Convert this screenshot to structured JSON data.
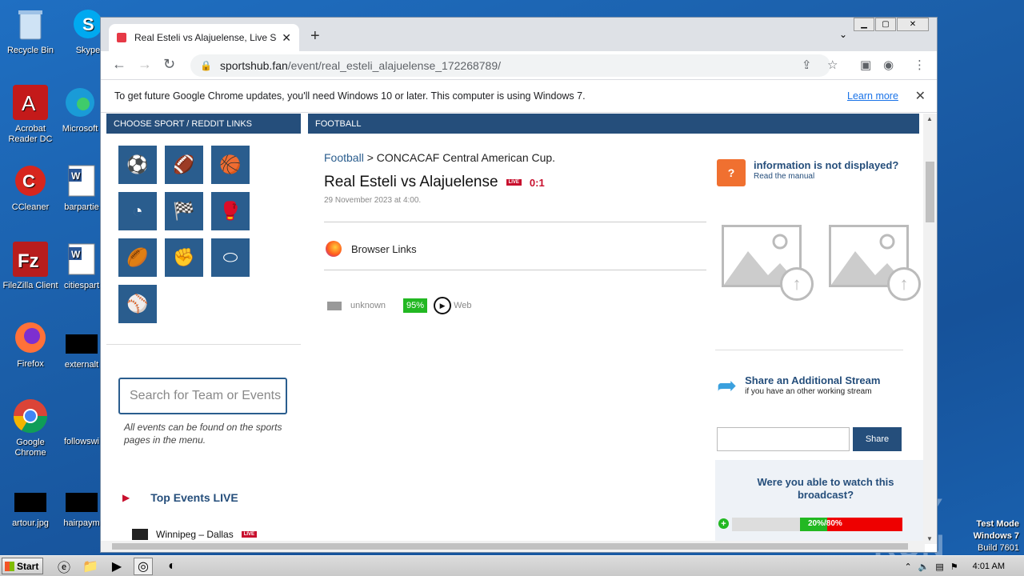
{
  "desktop": {
    "icons": [
      {
        "label": "Recycle Bin"
      },
      {
        "label": "Skype"
      },
      {
        "label": "Acrobat Reader DC"
      },
      {
        "label": "Microsoft"
      },
      {
        "label": "CCleaner"
      },
      {
        "label": "barpartie"
      },
      {
        "label": "FileZilla Client"
      },
      {
        "label": "citiespart"
      },
      {
        "label": "Firefox"
      },
      {
        "label": "externalt"
      },
      {
        "label": "Google Chrome"
      },
      {
        "label": "followswi"
      },
      {
        "label": "artour.jpg"
      },
      {
        "label": "hairpaym"
      }
    ],
    "watermark": {
      "line1": "Test Mode",
      "line2": "Windows 7",
      "line3": "Build 7601"
    },
    "anyrun_logo": "ANY RUN"
  },
  "taskbar": {
    "start_label": "Start",
    "clock": "4:01 AM"
  },
  "browser": {
    "tab_title": "Real Esteli vs Alajuelense, Live Score",
    "url_host": "sportshub.fan",
    "url_path": "/event/real_esteli_alajuelense_172268789/",
    "infobar_text": "To get future Google Chrome updates, you'll need Windows 10 or later. This computer is using Windows 7.",
    "infobar_link": "Learn more"
  },
  "page": {
    "left_header": "CHOOSE SPORT / REDDIT LINKS",
    "main_header": "FOOTBALL",
    "sports": [
      {
        "icon": "soccer-ball"
      },
      {
        "icon": "american-football"
      },
      {
        "icon": "basketball"
      },
      {
        "icon": "hockey"
      },
      {
        "icon": "racing-flag"
      },
      {
        "icon": "boxing-glove"
      },
      {
        "icon": "rugby-ball"
      },
      {
        "icon": "mma-fist"
      },
      {
        "icon": "aussie-rules"
      },
      {
        "icon": "baseball-bat"
      }
    ],
    "search_placeholder": "Search for Team or Events",
    "search_hint": "All events can be found on the sports pages in the menu.",
    "top_events_title": "Top Events LIVE",
    "top_event_1": "Winnipeg – Dallas",
    "live_badge": "LIVE",
    "breadcrumb_sport": "Football",
    "breadcrumb_sep": " > ",
    "breadcrumb_league": "CONCACAF Central American Cup.",
    "match_title": "Real Esteli vs Alajuelense",
    "score": "0:1",
    "match_date": "29 November 2023 at 4:00.",
    "browser_links_label": "Browser Links",
    "stream": {
      "name": "unknown",
      "quality": "95%",
      "type": "Web"
    },
    "info_heading": "information is not displayed?",
    "info_sub": "Read the manual",
    "share_heading": "Share an Additional Stream",
    "share_sub": "if you have an other working stream",
    "share_button": "Share",
    "vote_question": "Were you able to watch this broadcast?",
    "vote_yes": "20%",
    "vote_no": "80%",
    "vote_label": "20%/80%",
    "colors": {
      "navy": "#254e7b",
      "sport_tile": "#2a5d8e",
      "live_red": "#c8102e",
      "quality_green": "#22b822"
    }
  }
}
